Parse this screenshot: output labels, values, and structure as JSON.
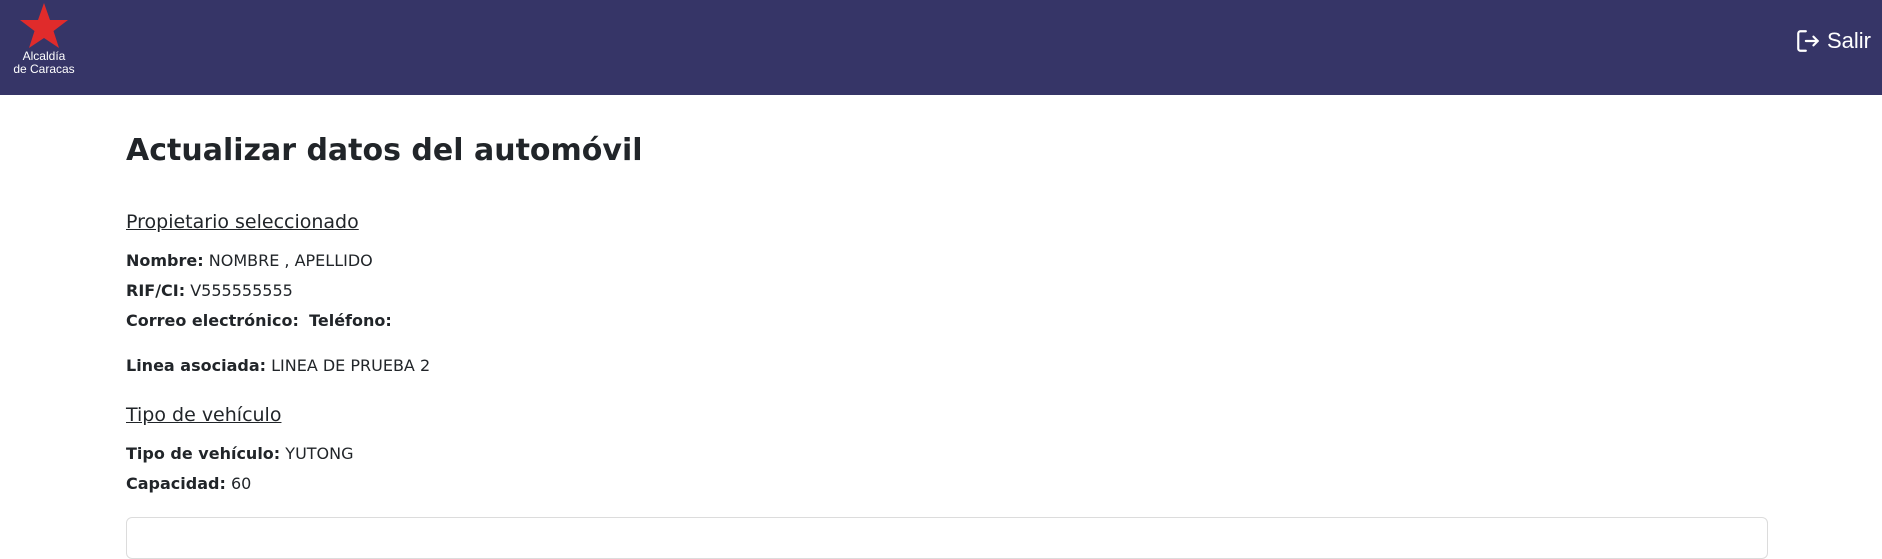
{
  "header": {
    "logo_text_line1": "Alcaldía",
    "logo_text_line2": "de Caracas",
    "logout_label": "Salir",
    "logo_color": "#e02b2b",
    "bar_color": "#363567"
  },
  "page": {
    "title": "Actualizar datos del automóvil"
  },
  "owner": {
    "section_title": "Propietario seleccionado",
    "name_label": "Nombre:",
    "name_value": "NOMBRE , APELLIDO",
    "rif_label": "RIF/CI:",
    "rif_value": "V555555555",
    "email_label": "Correo electrónico:",
    "email_value": "",
    "phone_label": "Teléfono:",
    "phone_value": "",
    "line_label": "Linea asociada:",
    "line_value": "LINEA DE PRUEBA 2"
  },
  "vehicle": {
    "section_title": "Tipo de vehículo",
    "type_label": "Tipo de vehículo:",
    "type_value": "YUTONG",
    "capacity_label": "Capacidad:",
    "capacity_value": "60"
  }
}
